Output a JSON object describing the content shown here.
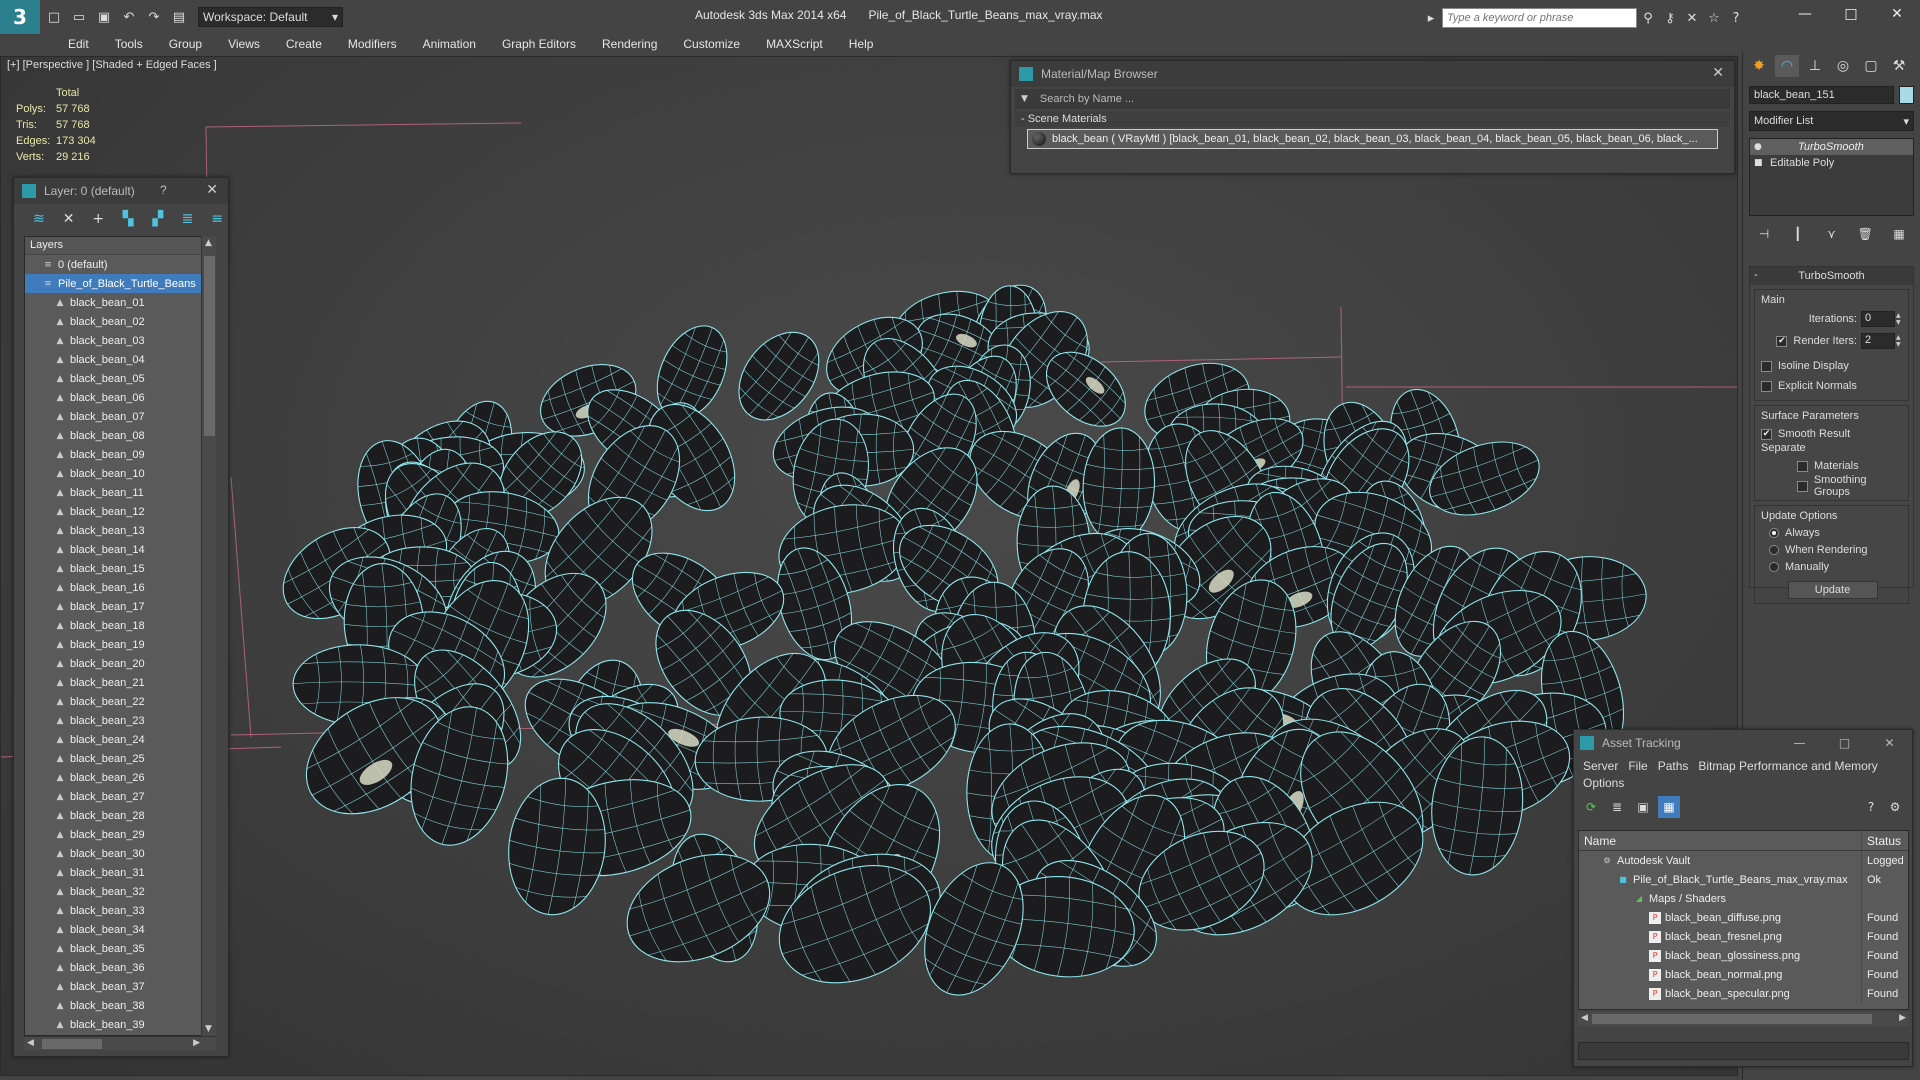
{
  "app": {
    "workspace": "Workspace: Default",
    "title_app": "Autodesk 3ds Max  2014 x64",
    "title_file": "Pile_of_Black_Turtle_Beans_max_vray.max",
    "search_placeholder": "Type a keyword or phrase"
  },
  "menu": [
    "Edit",
    "Tools",
    "Group",
    "Views",
    "Create",
    "Modifiers",
    "Animation",
    "Graph Editors",
    "Rendering",
    "Customize",
    "MAXScript",
    "Help"
  ],
  "viewport": {
    "label": "[+] [Perspective ] [Shaded + Edged Faces ]",
    "stats": {
      "header": "Total",
      "rows": [
        {
          "label": "Polys:",
          "value": "57 768"
        },
        {
          "label": "Tris:",
          "value": "57 768"
        },
        {
          "label": "Edges:",
          "value": "173 304"
        },
        {
          "label": "Verts:",
          "value": "29 216"
        }
      ]
    },
    "colors": {
      "wire": "#8fe6ec",
      "bean": "#1c1c1e",
      "grid": "#c86b86",
      "hilum": "#d8dcc4"
    }
  },
  "layer_panel": {
    "title": "Layer: 0 (default)",
    "help": "?",
    "column": "Layers",
    "default_layer": "0 (default)",
    "selected_layer": "Pile_of_Black_Turtle_Beans",
    "objects": [
      "black_bean_01",
      "black_bean_02",
      "black_bean_03",
      "black_bean_04",
      "black_bean_05",
      "black_bean_06",
      "black_bean_07",
      "black_bean_08",
      "black_bean_09",
      "black_bean_10",
      "black_bean_11",
      "black_bean_12",
      "black_bean_13",
      "black_bean_14",
      "black_bean_15",
      "black_bean_16",
      "black_bean_17",
      "black_bean_18",
      "black_bean_19",
      "black_bean_20",
      "black_bean_21",
      "black_bean_22",
      "black_bean_23",
      "black_bean_24",
      "black_bean_25",
      "black_bean_26",
      "black_bean_27",
      "black_bean_28",
      "black_bean_29",
      "black_bean_30",
      "black_bean_31",
      "black_bean_32",
      "black_bean_33",
      "black_bean_34",
      "black_bean_35",
      "black_bean_36",
      "black_bean_37",
      "black_bean_38",
      "black_bean_39"
    ]
  },
  "material_browser": {
    "title": "Material/Map Browser",
    "search": "Search by Name ...",
    "section": "- Scene Materials",
    "item": "black_bean  ( VRayMtl )  [black_bean_01, black_bean_02, black_bean_03, black_bean_04, black_bean_05, black_bean_06, black_..."
  },
  "command_panel": {
    "object_name": "black_bean_151",
    "modifier_list": "Modifier List",
    "stack": [
      "TurboSmooth",
      "Editable Poly"
    ],
    "rollout_title": "TurboSmooth",
    "main_group": "Main",
    "iterations_label": "Iterations:",
    "iterations_value": "0",
    "render_iters_label": "Render Iters:",
    "render_iters_value": "2",
    "isoline": "Isoline Display",
    "explicit_normals": "Explicit Normals",
    "surface_group": "Surface Parameters",
    "smooth_result": "Smooth Result",
    "separate": "Separate",
    "materials": "Materials",
    "smoothing_groups": "Smoothing Groups",
    "update_group": "Update Options",
    "always": "Always",
    "when_rendering": "When Rendering",
    "manually": "Manually",
    "update_button": "Update"
  },
  "asset_tracking": {
    "title": "Asset Tracking",
    "menu": [
      "Server",
      "File",
      "Paths",
      "Bitmap Performance and Memory",
      "Options"
    ],
    "col_name": "Name",
    "col_status": "Status",
    "rows": [
      {
        "name": "Autodesk Vault",
        "status": "Logged",
        "indent": 0
      },
      {
        "name": "Pile_of_Black_Turtle_Beans_max_vray.max",
        "status": "Ok",
        "indent": 1
      },
      {
        "name": "Maps / Shaders",
        "status": "",
        "indent": 2
      },
      {
        "name": "black_bean_diffuse.png",
        "status": "Found",
        "indent": 3
      },
      {
        "name": "black_bean_fresnel.png",
        "status": "Found",
        "indent": 3
      },
      {
        "name": "black_bean_glossiness.png",
        "status": "Found",
        "indent": 3
      },
      {
        "name": "black_bean_normal.png",
        "status": "Found",
        "indent": 3
      },
      {
        "name": "black_bean_specular.png",
        "status": "Found",
        "indent": 3
      }
    ]
  }
}
